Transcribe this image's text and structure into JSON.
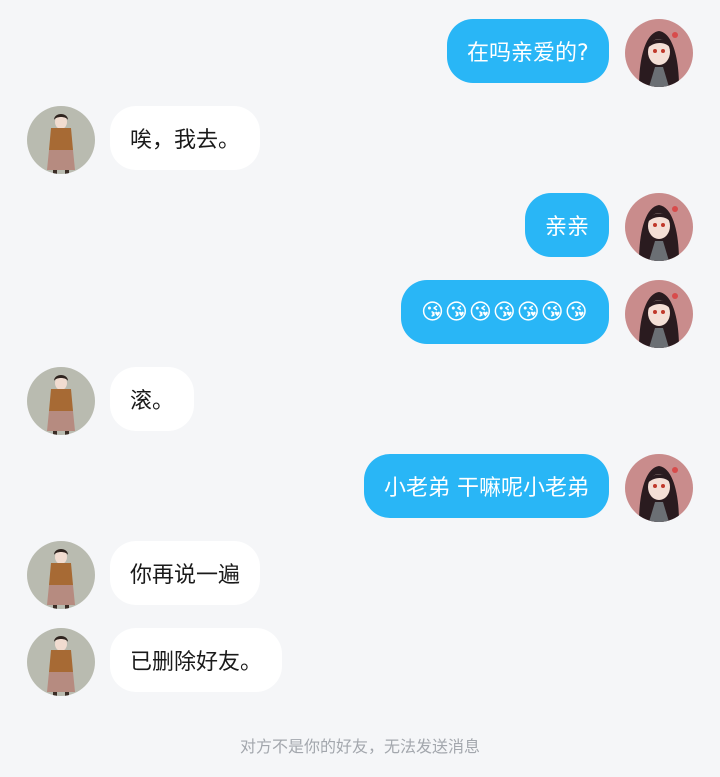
{
  "messages": [
    {
      "side": "out",
      "text": "在吗亲爱的?",
      "avatar": "girl-red-hair-avatar"
    },
    {
      "side": "in",
      "text": "唉，我去。",
      "avatar": "girl-brown-sweater-avatar"
    },
    {
      "side": "out",
      "text": "亲亲",
      "avatar": "girl-red-hair-avatar"
    },
    {
      "side": "out",
      "text": "😘😘😘😘😘😘😘",
      "avatar": "girl-red-hair-avatar"
    },
    {
      "side": "in",
      "text": "滚。",
      "avatar": "girl-brown-sweater-avatar"
    },
    {
      "side": "out",
      "text": "小老弟 干嘛呢小老弟",
      "avatar": "girl-red-hair-avatar"
    },
    {
      "side": "in",
      "text": "你再说一遍",
      "avatar": "girl-brown-sweater-avatar"
    },
    {
      "side": "in",
      "text": "已删除好友。",
      "avatar": "girl-brown-sweater-avatar"
    }
  ],
  "system_notice": "对方不是你的好友，无法发送消息",
  "colors": {
    "background": "#f5f6f8",
    "outgoing_bubble": "#29b6f6",
    "incoming_bubble": "#ffffff"
  }
}
